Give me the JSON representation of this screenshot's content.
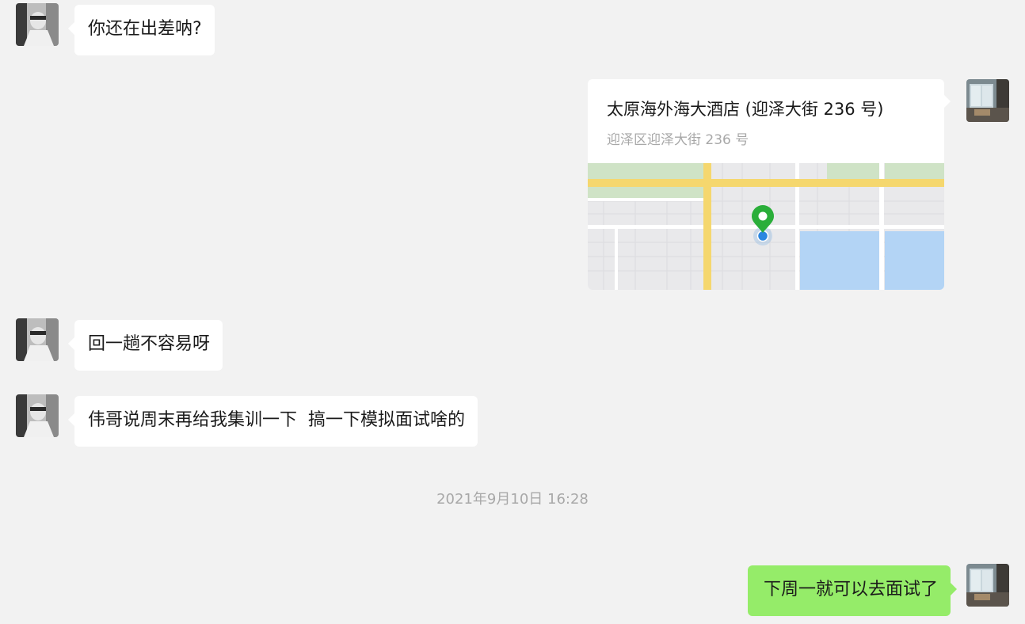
{
  "messages": [
    {
      "side": "incoming",
      "text": "你还在出差呐?"
    },
    {
      "side": "outgoing",
      "type": "location",
      "title": "太原海外海大酒店 (迎泽大街 236 号)",
      "address": "迎泽区迎泽大街 236 号"
    },
    {
      "side": "incoming",
      "text": "回一趟不容易呀"
    },
    {
      "side": "incoming",
      "text": "伟哥说周末再给我集训一下  搞一下模拟面试啥的"
    },
    {
      "side": "outgoing",
      "text": "下周一就可以去面试了"
    }
  ],
  "timestamp": "2021年9月10日 16:28",
  "colors": {
    "background": "#f2f2f2",
    "incoming_bubble": "#ffffff",
    "outgoing_bubble": "#95ec69",
    "map_road": "#f5d76e",
    "map_water": "#b3d4f5",
    "map_park": "#cfe3c6",
    "pin": "#2aae3a",
    "location_dot": "#2b86e0"
  },
  "icons": {
    "contact_avatar": "contact-avatar-photo",
    "self_avatar": "self-avatar-photo",
    "map_pin": "map-pin-icon"
  }
}
